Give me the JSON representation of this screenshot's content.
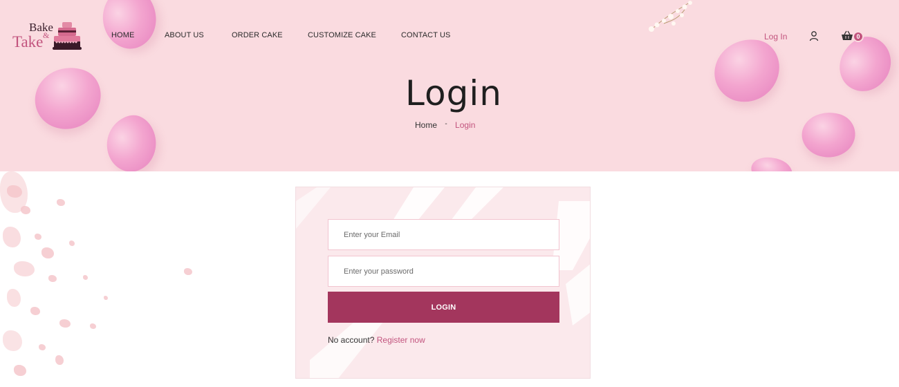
{
  "brand": {
    "logo_word1": "Bake",
    "logo_amp": "&",
    "logo_word2": "Take"
  },
  "nav": {
    "items": [
      {
        "label": "HOME"
      },
      {
        "label": "ABOUT US"
      },
      {
        "label": "ORDER CAKE"
      },
      {
        "label": "CUSTOMIZE CAKE"
      },
      {
        "label": "CONTACT US"
      }
    ],
    "login_label": "Log In",
    "cart_count": "0"
  },
  "hero": {
    "title": "Login",
    "breadcrumb": {
      "home": "Home",
      "separator": "-",
      "current": "Login"
    }
  },
  "form": {
    "email_placeholder": "Enter your Email",
    "password_placeholder": "Enter your password",
    "submit_label": "LOGIN",
    "no_account_text": "No account?",
    "register_label": "Register now"
  },
  "icons": {
    "user": "user-icon",
    "cart": "basket-icon",
    "logo": "cake-icon"
  },
  "colors": {
    "accent": "#c2547e",
    "button": "#a3365d",
    "hero_bg": "#fadbe0"
  }
}
